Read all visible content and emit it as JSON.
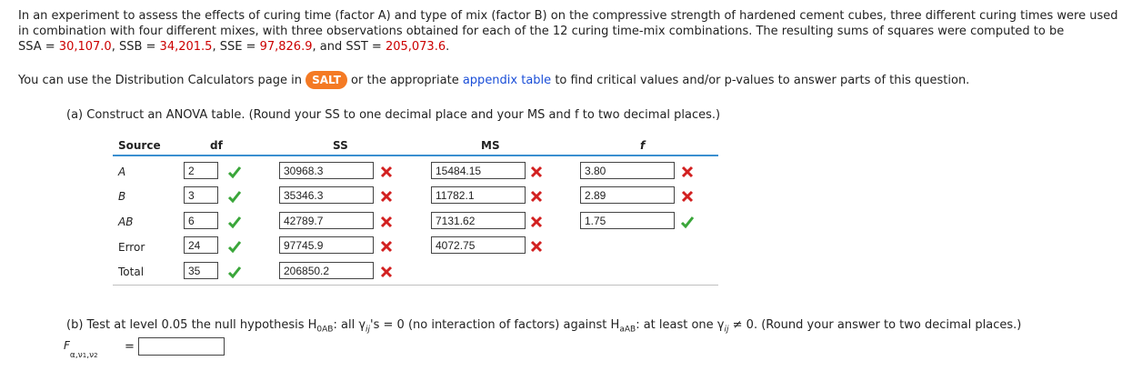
{
  "intro": {
    "line1": "In an experiment to assess the effects of curing time (factor A) and type of mix (factor B) on the compressive strength of hardened cement cubes, three different curing times were used",
    "line2": "in combination with four different mixes, with three observations obtained for each of the 12 curing time-mix combinations. The resulting sums of squares were computed to be",
    "ssa_label": "SSA = ",
    "ssa_value": "30,107.0",
    "ssb_label": ", SSB = ",
    "ssb_value": "34,201.5",
    "sse_label": ", SSE = ",
    "sse_value": "97,826.9",
    "sst_label": ", and SST = ",
    "sst_value": "205,073.6",
    "end": "."
  },
  "calc_line": {
    "before": "You can use the Distribution Calculators page in",
    "salt": "SALT",
    "middle": "or the appropriate",
    "link": "appendix table",
    "after": "to find critical values and/or p-values to answer parts of this question."
  },
  "part_a": {
    "prompt": "(a) Construct an ANOVA table. (Round your SS to one decimal place and your MS and f to two decimal places.)",
    "headers": {
      "source": "Source",
      "df": "df",
      "ss": "SS",
      "ms": "MS",
      "f": "f"
    },
    "rows": [
      {
        "source": "A",
        "df": "2",
        "ss": "30968.3",
        "ms": "15484.15",
        "f": "3.80"
      },
      {
        "source": "B",
        "df": "3",
        "ss": "35346.3",
        "ms": "11782.1",
        "f": "2.89"
      },
      {
        "source": "AB",
        "df": "6",
        "ss": "42789.7",
        "ms": "7131.62",
        "f": "1.75"
      },
      {
        "source": "Error",
        "df": "24",
        "ss": "97745.9",
        "ms": "4072.75"
      },
      {
        "source": "Total",
        "df": "35",
        "ss": "206850.2"
      }
    ],
    "status": {
      "df": "correct",
      "ss": "incorrect",
      "ms": "incorrect",
      "f": [
        "incorrect",
        "incorrect",
        "correct"
      ]
    },
    "colors": {
      "correct": "#3aa63a",
      "incorrect": "#d22020",
      "header_rule": "#3a8fd0"
    }
  },
  "part_b": {
    "p1": "(b) Test at level 0.05 the null hypothesis H",
    "h0_sub": "0AB",
    "p2": ": all γ",
    "ij1": "ij",
    "p3": "'s = 0 (no interaction of factors) against H",
    "ha_sub": "aAB",
    "p4": ": at least one γ",
    "ij2": "ij",
    "p5": " ≠ 0. (Round your answer to two decimal places.)",
    "f_label": "F",
    "f_sub": "α,ν",
    "f_sub2": "1",
    "f_sub3": ",ν",
    "f_sub4": "2",
    "equals": "=",
    "answer": ""
  }
}
